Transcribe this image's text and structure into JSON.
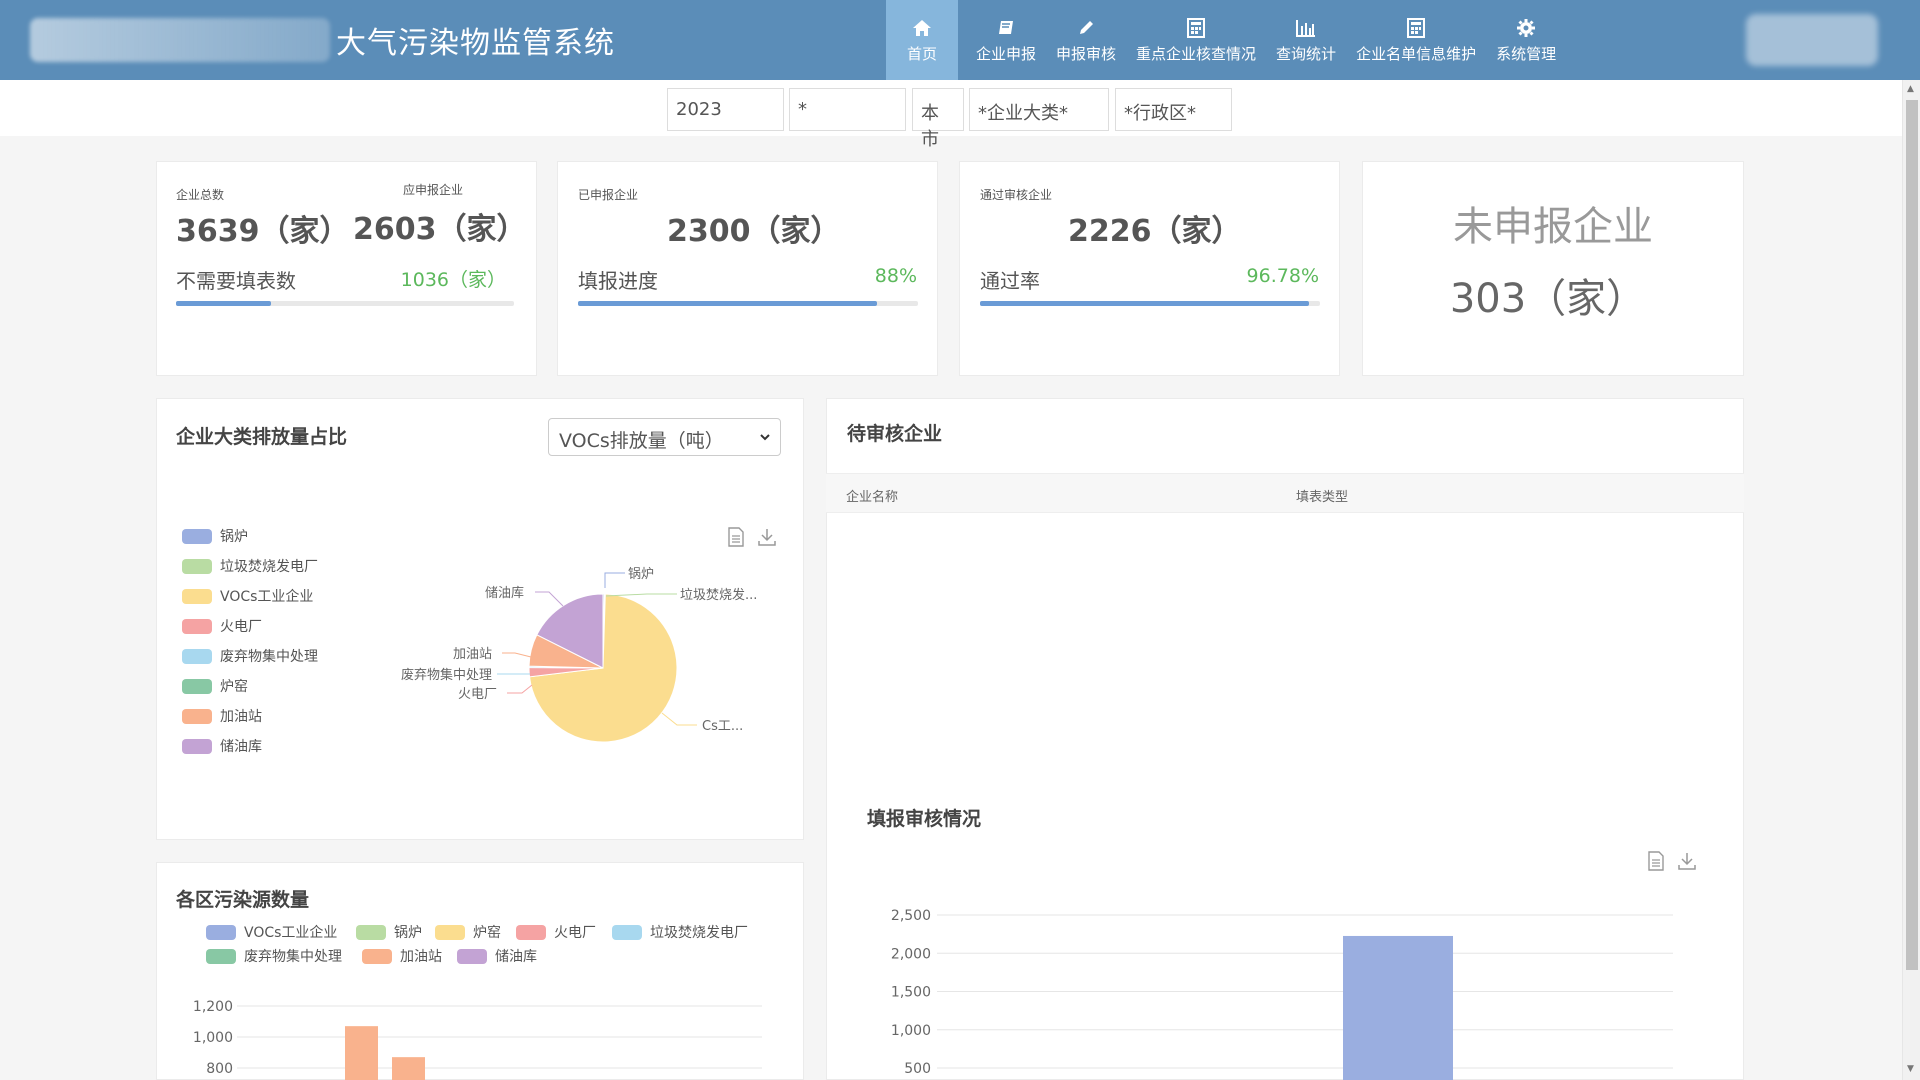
{
  "header": {
    "title": "大气污染物监管系统",
    "nav": [
      {
        "label": "首页",
        "icon": "home-icon",
        "active": true
      },
      {
        "label": "企业申报",
        "icon": "book-icon"
      },
      {
        "label": "申报审核",
        "icon": "pencil-icon"
      },
      {
        "label": "重点企业核查情况",
        "icon": "calculator-icon"
      },
      {
        "label": "查询统计",
        "icon": "bar-chart-icon"
      },
      {
        "label": "企业名单信息维护",
        "icon": "calculator-icon"
      },
      {
        "label": "系统管理",
        "icon": "gear-icon"
      }
    ]
  },
  "filters": {
    "year": "2023",
    "star": "*",
    "city": "本市",
    "category": "*企业大类*",
    "district": "*行政区*"
  },
  "stats": {
    "card1": {
      "total_label": "企业总数",
      "total_value": "3639（家）",
      "should_label": "应申报企业",
      "should_value": "2603（家）",
      "row_label": "不需要填表数",
      "row_value": "1036（家）",
      "progress": 0.28
    },
    "card2": {
      "label": "已申报企业",
      "value": "2300（家）",
      "row_label": "填报进度",
      "row_value": "88%",
      "progress": 0.88
    },
    "card3": {
      "label": "通过审核企业",
      "value": "2226（家）",
      "row_label": "通过率",
      "row_value": "96.78%",
      "progress": 0.9678
    },
    "card4": {
      "title": "未申报企业",
      "value": "303（家）"
    }
  },
  "pie_panel": {
    "title": "企业大类排放量占比",
    "select_value": "VOCs排放量（吨）",
    "legend": [
      "锅炉",
      "垃圾焚烧发电厂",
      "VOCs工业企业",
      "火电厂",
      "废弃物集中处理",
      "炉窑",
      "加油站",
      "储油库"
    ],
    "colors": {
      "锅炉": "#9aaee0",
      "垃圾焚烧发电厂": "#b9dca3",
      "VOCs工业企业": "#fbdd8f",
      "火电厂": "#f5a3a3",
      "废弃物集中处理": "#a8d8ef",
      "炉窑": "#88c8a4",
      "加油站": "#f9b28d",
      "储油库": "#c3a3d4"
    },
    "pie_labels": {
      "guolu": "锅炉",
      "lajifenshao": "垃圾焚烧发...",
      "chuyouku": "储油库",
      "jiayouzhan": "加油站",
      "feiqiwu": "废弃物集中处理",
      "huodianchang": "火电厂",
      "vocs": "Cs工..."
    }
  },
  "pending_panel": {
    "title": "待审核企业",
    "col_name": "企业名称",
    "col_type": "填表类型"
  },
  "district_panel": {
    "title": "各区污染源数量",
    "legend": [
      "VOCs工业企业",
      "锅炉",
      "炉窑",
      "火电厂",
      "垃圾焚烧发电厂",
      "废弃物集中处理",
      "加油站",
      "储油库"
    ],
    "colors": {
      "VOCs工业企业": "#9aaee0",
      "锅炉": "#b9dca3",
      "炉窑": "#fbdd8f",
      "火电厂": "#f5a3a3",
      "垃圾焚烧发电厂": "#a8d8ef",
      "废弃物集中处理": "#88c8a4",
      "加油站": "#f9b28d",
      "储油库": "#c3a3d4"
    }
  },
  "review_panel": {
    "title": "填报审核情况"
  },
  "chart_data": [
    {
      "type": "pie",
      "title": "企业大类排放量占比",
      "labels": [
        "锅炉",
        "垃圾焚烧发电厂",
        "VOCs工业企业",
        "火电厂",
        "废弃物集中处理",
        "炉窑",
        "加油站",
        "储油库"
      ],
      "values": [
        0.3,
        0.2,
        72.6,
        2.0,
        0.3,
        0,
        7.0,
        17.6
      ]
    },
    {
      "type": "bar",
      "title": "各区污染源数量",
      "ylim": [
        800,
        1200
      ],
      "yticks": [
        "1,200",
        "1,000",
        "800"
      ],
      "series": [
        {
          "name": "加油站",
          "values": [
            1070,
            870
          ]
        }
      ]
    },
    {
      "type": "bar",
      "title": "填报审核情况",
      "ylim": [
        500,
        2500
      ],
      "yticks": [
        "2,500",
        "2,000",
        "1,500",
        "1,000",
        "500"
      ],
      "values": [
        2226
      ]
    }
  ]
}
